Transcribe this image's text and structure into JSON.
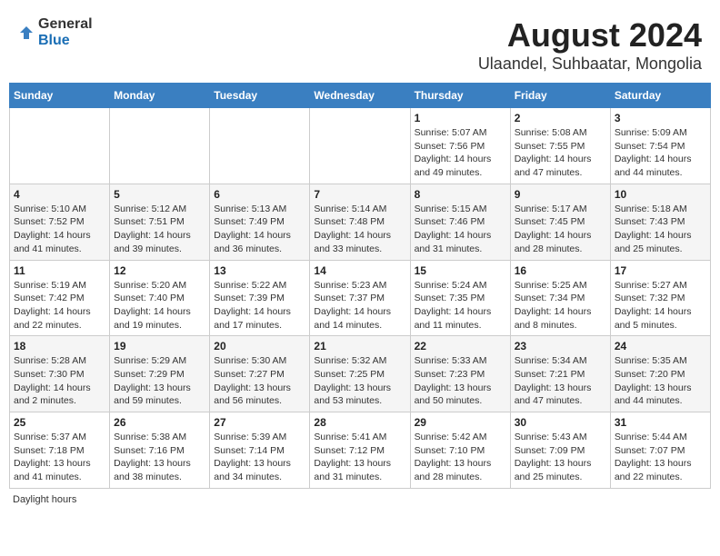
{
  "logo": {
    "general": "General",
    "blue": "Blue"
  },
  "title": "August 2024",
  "subtitle": "Ulaandel, Suhbaatar, Mongolia",
  "days_of_week": [
    "Sunday",
    "Monday",
    "Tuesday",
    "Wednesday",
    "Thursday",
    "Friday",
    "Saturday"
  ],
  "footer": "Daylight hours",
  "weeks": [
    [
      {
        "day": "",
        "sunrise": "",
        "sunset": "",
        "daylight": ""
      },
      {
        "day": "",
        "sunrise": "",
        "sunset": "",
        "daylight": ""
      },
      {
        "day": "",
        "sunrise": "",
        "sunset": "",
        "daylight": ""
      },
      {
        "day": "",
        "sunrise": "",
        "sunset": "",
        "daylight": ""
      },
      {
        "day": "1",
        "sunrise": "Sunrise: 5:07 AM",
        "sunset": "Sunset: 7:56 PM",
        "daylight": "Daylight: 14 hours and 49 minutes."
      },
      {
        "day": "2",
        "sunrise": "Sunrise: 5:08 AM",
        "sunset": "Sunset: 7:55 PM",
        "daylight": "Daylight: 14 hours and 47 minutes."
      },
      {
        "day": "3",
        "sunrise": "Sunrise: 5:09 AM",
        "sunset": "Sunset: 7:54 PM",
        "daylight": "Daylight: 14 hours and 44 minutes."
      }
    ],
    [
      {
        "day": "4",
        "sunrise": "Sunrise: 5:10 AM",
        "sunset": "Sunset: 7:52 PM",
        "daylight": "Daylight: 14 hours and 41 minutes."
      },
      {
        "day": "5",
        "sunrise": "Sunrise: 5:12 AM",
        "sunset": "Sunset: 7:51 PM",
        "daylight": "Daylight: 14 hours and 39 minutes."
      },
      {
        "day": "6",
        "sunrise": "Sunrise: 5:13 AM",
        "sunset": "Sunset: 7:49 PM",
        "daylight": "Daylight: 14 hours and 36 minutes."
      },
      {
        "day": "7",
        "sunrise": "Sunrise: 5:14 AM",
        "sunset": "Sunset: 7:48 PM",
        "daylight": "Daylight: 14 hours and 33 minutes."
      },
      {
        "day": "8",
        "sunrise": "Sunrise: 5:15 AM",
        "sunset": "Sunset: 7:46 PM",
        "daylight": "Daylight: 14 hours and 31 minutes."
      },
      {
        "day": "9",
        "sunrise": "Sunrise: 5:17 AM",
        "sunset": "Sunset: 7:45 PM",
        "daylight": "Daylight: 14 hours and 28 minutes."
      },
      {
        "day": "10",
        "sunrise": "Sunrise: 5:18 AM",
        "sunset": "Sunset: 7:43 PM",
        "daylight": "Daylight: 14 hours and 25 minutes."
      }
    ],
    [
      {
        "day": "11",
        "sunrise": "Sunrise: 5:19 AM",
        "sunset": "Sunset: 7:42 PM",
        "daylight": "Daylight: 14 hours and 22 minutes."
      },
      {
        "day": "12",
        "sunrise": "Sunrise: 5:20 AM",
        "sunset": "Sunset: 7:40 PM",
        "daylight": "Daylight: 14 hours and 19 minutes."
      },
      {
        "day": "13",
        "sunrise": "Sunrise: 5:22 AM",
        "sunset": "Sunset: 7:39 PM",
        "daylight": "Daylight: 14 hours and 17 minutes."
      },
      {
        "day": "14",
        "sunrise": "Sunrise: 5:23 AM",
        "sunset": "Sunset: 7:37 PM",
        "daylight": "Daylight: 14 hours and 14 minutes."
      },
      {
        "day": "15",
        "sunrise": "Sunrise: 5:24 AM",
        "sunset": "Sunset: 7:35 PM",
        "daylight": "Daylight: 14 hours and 11 minutes."
      },
      {
        "day": "16",
        "sunrise": "Sunrise: 5:25 AM",
        "sunset": "Sunset: 7:34 PM",
        "daylight": "Daylight: 14 hours and 8 minutes."
      },
      {
        "day": "17",
        "sunrise": "Sunrise: 5:27 AM",
        "sunset": "Sunset: 7:32 PM",
        "daylight": "Daylight: 14 hours and 5 minutes."
      }
    ],
    [
      {
        "day": "18",
        "sunrise": "Sunrise: 5:28 AM",
        "sunset": "Sunset: 7:30 PM",
        "daylight": "Daylight: 14 hours and 2 minutes."
      },
      {
        "day": "19",
        "sunrise": "Sunrise: 5:29 AM",
        "sunset": "Sunset: 7:29 PM",
        "daylight": "Daylight: 13 hours and 59 minutes."
      },
      {
        "day": "20",
        "sunrise": "Sunrise: 5:30 AM",
        "sunset": "Sunset: 7:27 PM",
        "daylight": "Daylight: 13 hours and 56 minutes."
      },
      {
        "day": "21",
        "sunrise": "Sunrise: 5:32 AM",
        "sunset": "Sunset: 7:25 PM",
        "daylight": "Daylight: 13 hours and 53 minutes."
      },
      {
        "day": "22",
        "sunrise": "Sunrise: 5:33 AM",
        "sunset": "Sunset: 7:23 PM",
        "daylight": "Daylight: 13 hours and 50 minutes."
      },
      {
        "day": "23",
        "sunrise": "Sunrise: 5:34 AM",
        "sunset": "Sunset: 7:21 PM",
        "daylight": "Daylight: 13 hours and 47 minutes."
      },
      {
        "day": "24",
        "sunrise": "Sunrise: 5:35 AM",
        "sunset": "Sunset: 7:20 PM",
        "daylight": "Daylight: 13 hours and 44 minutes."
      }
    ],
    [
      {
        "day": "25",
        "sunrise": "Sunrise: 5:37 AM",
        "sunset": "Sunset: 7:18 PM",
        "daylight": "Daylight: 13 hours and 41 minutes."
      },
      {
        "day": "26",
        "sunrise": "Sunrise: 5:38 AM",
        "sunset": "Sunset: 7:16 PM",
        "daylight": "Daylight: 13 hours and 38 minutes."
      },
      {
        "day": "27",
        "sunrise": "Sunrise: 5:39 AM",
        "sunset": "Sunset: 7:14 PM",
        "daylight": "Daylight: 13 hours and 34 minutes."
      },
      {
        "day": "28",
        "sunrise": "Sunrise: 5:41 AM",
        "sunset": "Sunset: 7:12 PM",
        "daylight": "Daylight: 13 hours and 31 minutes."
      },
      {
        "day": "29",
        "sunrise": "Sunrise: 5:42 AM",
        "sunset": "Sunset: 7:10 PM",
        "daylight": "Daylight: 13 hours and 28 minutes."
      },
      {
        "day": "30",
        "sunrise": "Sunrise: 5:43 AM",
        "sunset": "Sunset: 7:09 PM",
        "daylight": "Daylight: 13 hours and 25 minutes."
      },
      {
        "day": "31",
        "sunrise": "Sunrise: 5:44 AM",
        "sunset": "Sunset: 7:07 PM",
        "daylight": "Daylight: 13 hours and 22 minutes."
      }
    ]
  ]
}
